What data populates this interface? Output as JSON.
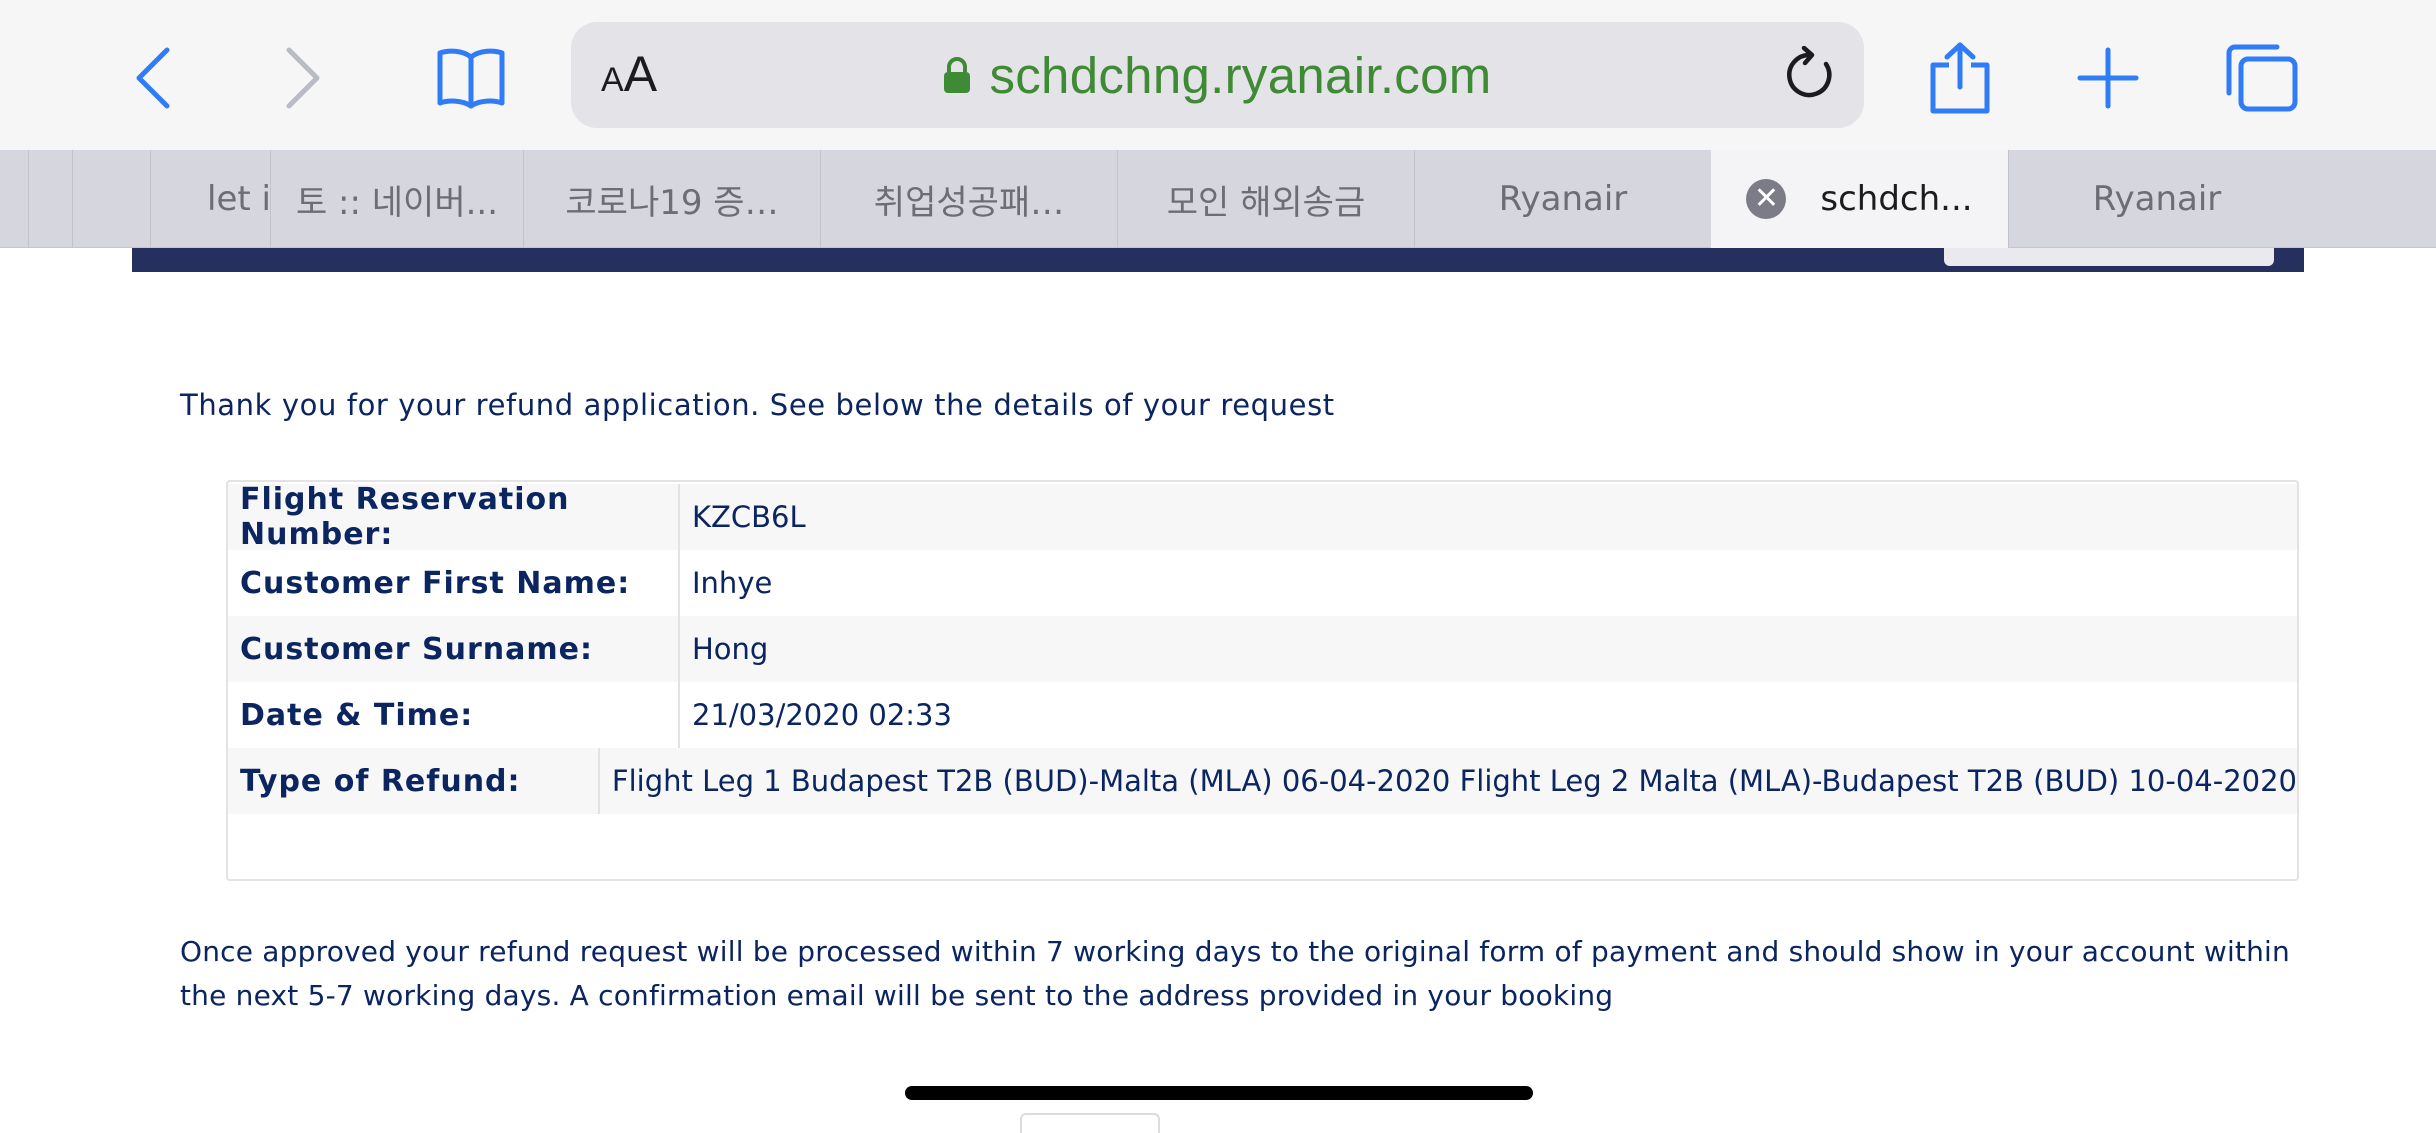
{
  "browser": {
    "text_size_button": {
      "small": "A",
      "big": "A"
    },
    "url": "schdchng.ryanair.com",
    "tabs": [
      {
        "label": "let i"
      },
      {
        "label": "토 :: 네이버..."
      },
      {
        "label": "코로나19 증…"
      },
      {
        "label": "취업성공패…"
      },
      {
        "label": "모인 해외송금"
      },
      {
        "label": "Ryanair"
      },
      {
        "label": "schdch...",
        "active": true
      },
      {
        "label": "Ryanair"
      }
    ],
    "close_glyph": "✕"
  },
  "page": {
    "intro": "Thank you for your refund application. See below the details of your request",
    "details": [
      {
        "label": "Flight Reservation Number:",
        "value": "KZCB6L"
      },
      {
        "label": "Customer First Name:",
        "value": "Inhye"
      },
      {
        "label": "Customer Surname:",
        "value": "Hong"
      },
      {
        "label": "Date & Time:",
        "value": "21/03/2020 02:33"
      },
      {
        "label": "Type of Refund:",
        "value": "Flight Leg 1 Budapest T2B (BUD)-Malta (MLA) 06-04-2020 Flight Leg 2 Malta (MLA)-Budapest T2B (BUD) 10-04-2020"
      }
    ],
    "note": "Once approved your refund request will be processed within 7 working days to the original form of payment and should show in your account within the next 5-7 working days. A confirmation email will be sent to the address provided in your booking"
  },
  "colors": {
    "accent": "#2f7cf6",
    "url_green": "#3f8a34",
    "navy": "#0b2560",
    "header_bar": "#26305e"
  },
  "icons": [
    "back-icon",
    "forward-icon",
    "bookmarks-icon",
    "lock-icon",
    "reload-icon",
    "share-icon",
    "new-tab-icon",
    "tabs-overview-icon",
    "tab-close-icon"
  ]
}
